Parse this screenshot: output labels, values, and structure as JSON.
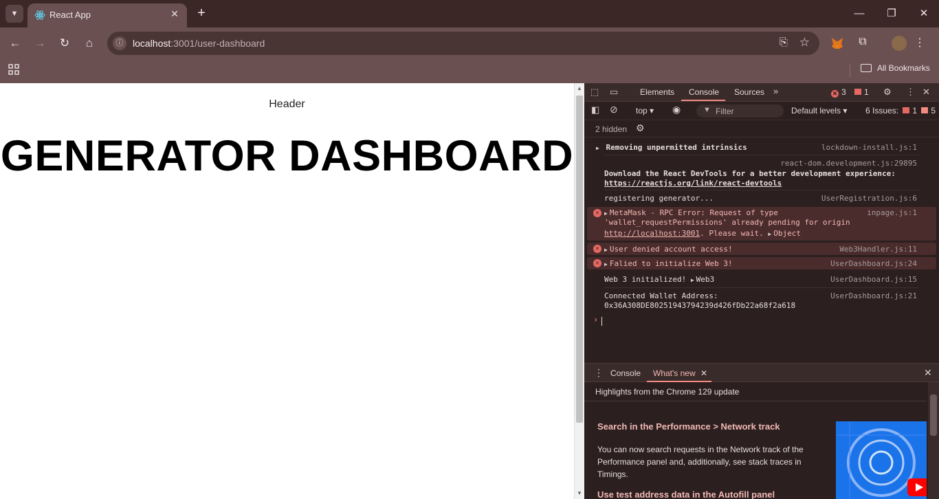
{
  "browser": {
    "tab_title": "React App",
    "url_host": "localhost",
    "url_path": ":3001/user-dashboard",
    "bookmarks_label": "All Bookmarks"
  },
  "page": {
    "header": "Header",
    "title": "GENERATOR DASHBOARD"
  },
  "devtools": {
    "tabs": [
      "Elements",
      "Console",
      "Sources"
    ],
    "active_tab": "Console",
    "error_count": "3",
    "warning_count": "1",
    "context": "top",
    "filter_placeholder": "Filter",
    "levels": "Default levels",
    "issues_label": "6 Issues:",
    "issues_errors": "1",
    "issues_warnings": "5",
    "hidden": "2 hidden",
    "messages": [
      {
        "text": "Removing unpermitted intrinsics",
        "source": "lockdown-install.js:1"
      },
      {
        "source": "react-dom.development.js:29895",
        "text": "Download the React DevTools for a better development experience:",
        "link": "https://reactjs.org/link/react-devtools"
      },
      {
        "text": "registering generator...",
        "source": "UserRegistration.js:6"
      },
      {
        "text": "MetaMask - RPC Error: Request of type",
        "text2": "'wallet_requestPermissions' already pending for origin",
        "link": "http://localhost:3001",
        "text3": ". Please wait.",
        "object": "Object",
        "source": "inpage.js:1"
      },
      {
        "text": "User denied account access!",
        "source": "Web3Handler.js:11"
      },
      {
        "text": "Falied to initialize Web 3!",
        "source": "UserDashboard.js:24"
      },
      {
        "text": "Web 3 initialized!",
        "object": "Web3",
        "source": "UserDashboard.js:15"
      },
      {
        "text": "Connected Wallet Address:",
        "text2": "0x36A308DE80251943794239d426fDb22a68f2a618",
        "source": "UserDashboard.js:21"
      }
    ],
    "drawer": {
      "console_tab": "Console",
      "whatsnew_tab": "What's new",
      "highlights": "Highlights from the Chrome 129 update",
      "heading1": "Search in the Performance > Network track",
      "para1": "You can now search requests in the Network track of the Performance panel and, additionally, see stack traces in Timings.",
      "heading2": "Use test address data in the Autofill panel"
    }
  },
  "colors": {
    "chrome_bg": "#6a5050",
    "devtools_bg": "#2b1f1f",
    "error_red": "#e46962",
    "accent": "#f28b82"
  }
}
